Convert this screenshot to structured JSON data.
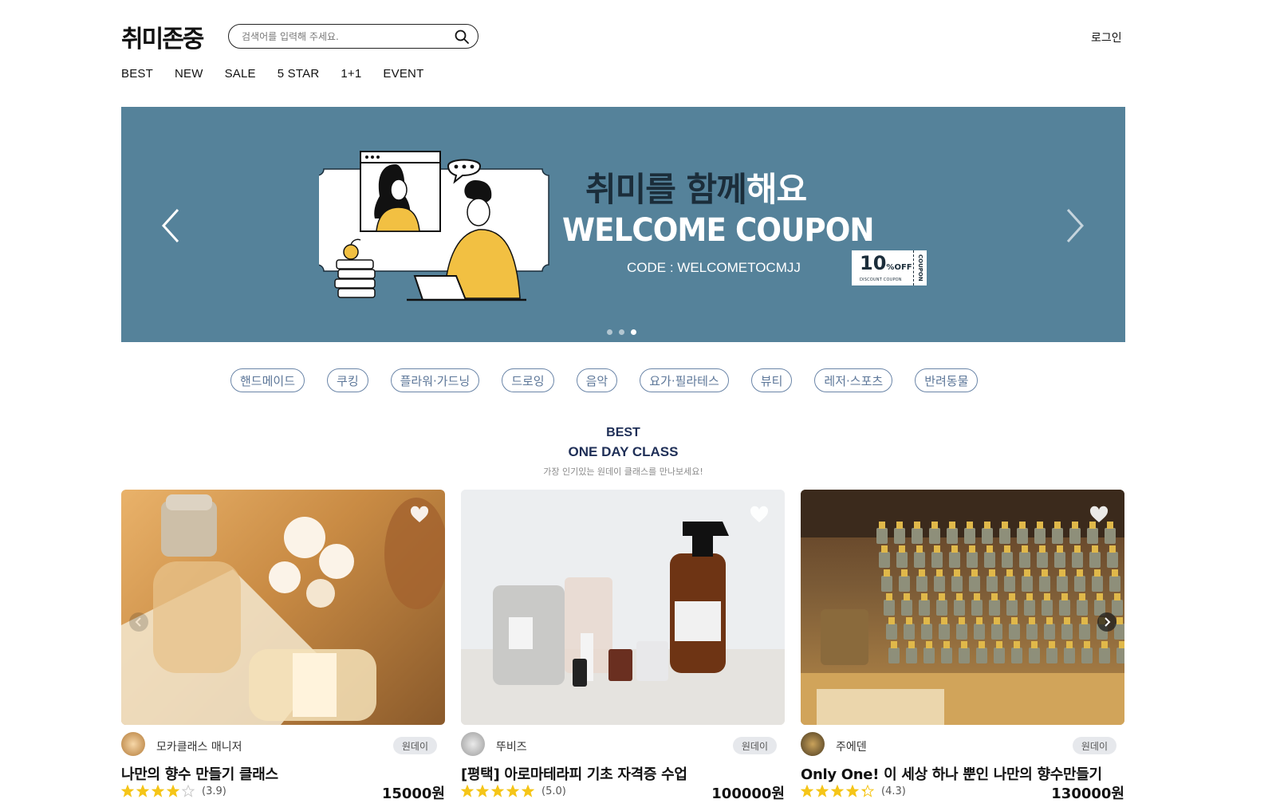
{
  "header": {
    "logo": "취미존중",
    "search_placeholder": "검색어를 입력해 주세요.",
    "login": "로그인"
  },
  "nav": [
    "BEST",
    "NEW",
    "SALE",
    "5 STAR",
    "1+1",
    "EVENT"
  ],
  "banner": {
    "title_dark": "취미를 함께",
    "title_light": "해요",
    "subtitle": "WELCOME COUPON",
    "code": "CODE : WELCOMETOCMJJ",
    "coupon_percent": "10",
    "coupon_off": "OFF",
    "coupon_small": "DISCOUNT COUPON",
    "coupon_side": "COUPON",
    "background": "#55829a",
    "slides": 3,
    "active_slide": 3
  },
  "categories": [
    "핸드메이드",
    "쿠킹",
    "플라워·가드닝",
    "드로잉",
    "음악",
    "요가·필라테스",
    "뷰티",
    "레저·스포츠",
    "반려동물"
  ],
  "section": {
    "label": "BEST",
    "title": "ONE DAY CLASS",
    "desc": "가장 인기있는 원데이 클래스를 만나보세요!"
  },
  "cards": [
    {
      "host": "모카클래스 매니저",
      "badge": "원데이",
      "title": "나만의 향수 만들기 클래스",
      "rating": 3.9,
      "rating_text": "(3.9)",
      "price": "15000원"
    },
    {
      "host": "뚜비즈",
      "badge": "원데이",
      "title": "[평택] 아로마테라피 기초 자격증 수업",
      "rating": 5.0,
      "rating_text": "(5.0)",
      "price": "100000원"
    },
    {
      "host": "주에덴",
      "badge": "원데이",
      "title": "Only One! 이 세상 하나 뿐인 나만의 향수만들기",
      "rating": 4.3,
      "rating_text": "(4.3)",
      "price": "130000원"
    }
  ],
  "colors": {
    "accent": "#1f2f57",
    "category_border": "#6a85a8",
    "star": "#f5c518"
  }
}
